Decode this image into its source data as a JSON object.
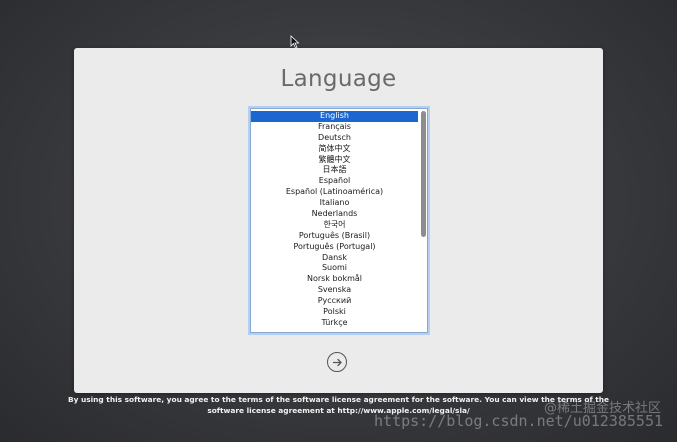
{
  "page": {
    "title": "Language"
  },
  "languages": {
    "selected_index": 0,
    "items": [
      "English",
      "Français",
      "Deutsch",
      "简体中文",
      "繁體中文",
      "日本語",
      "Español",
      "Español (Latinoamérica)",
      "Italiano",
      "Nederlands",
      "한국어",
      "Português (Brasil)",
      "Português (Portugal)",
      "Dansk",
      "Suomi",
      "Norsk bokmål",
      "Svenska",
      "Русский",
      "Polski",
      "Türkçe"
    ]
  },
  "license": {
    "text_before": "By using this software, you agree to the terms of the software license agreement for the software. You can view the terms of the software license agreement at ",
    "link": "http://www.apple.com/legal/sla/",
    "text_after": ""
  },
  "watermark": {
    "top": "@稀土掘金技术社区",
    "bottom": "https://blog.csdn.net/u012385551"
  },
  "icons": {
    "next": "arrow-right-circle-icon",
    "cursor": "mouse-pointer-icon"
  },
  "colors": {
    "selection": "#1a67d2",
    "list_border": "#86a9d4",
    "panel": "#ebebeb",
    "title": "#6a6a6a"
  }
}
